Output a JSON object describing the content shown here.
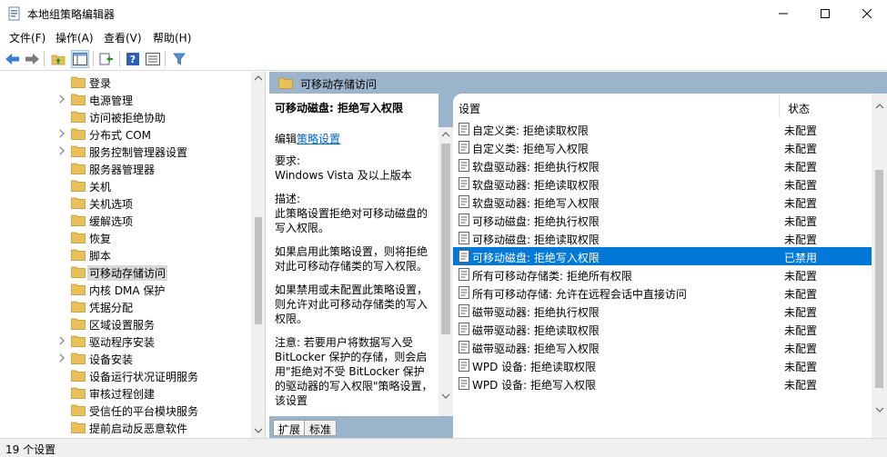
{
  "window": {
    "title": "本地组策略编辑器"
  },
  "menu": [
    {
      "label": "文件(F)"
    },
    {
      "label": "操作(A)"
    },
    {
      "label": "查看(V)"
    },
    {
      "label": "帮助(H)"
    }
  ],
  "toolbar": {
    "icons": [
      "back-arrow-icon",
      "forward-arrow-icon",
      "up-folder-icon",
      "show-hide-tree-icon",
      "export-list-icon",
      "help-icon",
      "properties-icon",
      "filter-icon"
    ]
  },
  "tree": {
    "items": [
      {
        "label": "登录",
        "has_children": false
      },
      {
        "label": "电源管理",
        "has_children": true
      },
      {
        "label": "访问被拒绝协助",
        "has_children": false
      },
      {
        "label": "分布式 COM",
        "has_children": true
      },
      {
        "label": "服务控制管理器设置",
        "has_children": true
      },
      {
        "label": "服务器管理器",
        "has_children": false
      },
      {
        "label": "关机",
        "has_children": false
      },
      {
        "label": "关机选项",
        "has_children": false
      },
      {
        "label": "缓解选项",
        "has_children": false
      },
      {
        "label": "恢复",
        "has_children": false
      },
      {
        "label": "脚本",
        "has_children": false
      },
      {
        "label": "可移动存储访问",
        "has_children": false,
        "selected": true
      },
      {
        "label": "内核 DMA 保护",
        "has_children": false
      },
      {
        "label": "凭据分配",
        "has_children": false
      },
      {
        "label": "区域设置服务",
        "has_children": false
      },
      {
        "label": "驱动程序安装",
        "has_children": true
      },
      {
        "label": "设备安装",
        "has_children": true
      },
      {
        "label": "设备运行状况证明服务",
        "has_children": false
      },
      {
        "label": "审核过程创建",
        "has_children": false
      },
      {
        "label": "受信任的平台模块服务",
        "has_children": false
      },
      {
        "label": "提前启动反恶意软件",
        "has_children": false
      }
    ]
  },
  "right_panel": {
    "header": "可移动存储访问"
  },
  "description": {
    "title": "可移动磁盘: 拒绝写入权限",
    "edit_prefix": "编辑",
    "edit_link": "策略设置",
    "requirements_label": "要求:",
    "requirements": "Windows Vista 及以上版本",
    "desc_label": "描述:",
    "desc_text": "此策略设置拒绝对可移动磁盘的写入权限。",
    "enabled_text": "如果启用此策略设置，则将拒绝对此可移动存储类的写入权限。",
    "disabled_text": "如果禁用或未配置此策略设置，则允许对此可移动存储类的写入权限。",
    "note_text": "注意: 若要用户将数据写入受 BitLocker 保护的存储，则会启用\"拒绝对不受 BitLocker 保护的驱动器的写入权限\"策略设置，该设置"
  },
  "tabs": [
    {
      "label": "扩展"
    },
    {
      "label": "标准"
    }
  ],
  "list": {
    "columns": {
      "setting": "设置",
      "state": "状态"
    },
    "rows": [
      {
        "name": "自定义类: 拒绝读取权限",
        "state": "未配置"
      },
      {
        "name": "自定义类: 拒绝写入权限",
        "state": "未配置"
      },
      {
        "name": "软盘驱动器: 拒绝执行权限",
        "state": "未配置"
      },
      {
        "name": "软盘驱动器: 拒绝读取权限",
        "state": "未配置"
      },
      {
        "name": "软盘驱动器: 拒绝写入权限",
        "state": "未配置"
      },
      {
        "name": "可移动磁盘: 拒绝执行权限",
        "state": "未配置"
      },
      {
        "name": "可移动磁盘: 拒绝读取权限",
        "state": "未配置"
      },
      {
        "name": "可移动磁盘: 拒绝写入权限",
        "state": "已禁用",
        "selected": true
      },
      {
        "name": "所有可移动存储类: 拒绝所有权限",
        "state": "未配置"
      },
      {
        "name": "所有可移动存储: 允许在远程会话中直接访问",
        "state": "未配置"
      },
      {
        "name": "磁带驱动器: 拒绝执行权限",
        "state": "未配置"
      },
      {
        "name": "磁带驱动器: 拒绝读取权限",
        "state": "未配置"
      },
      {
        "name": "磁带驱动器: 拒绝写入权限",
        "state": "未配置"
      },
      {
        "name": "WPD 设备: 拒绝读取权限",
        "state": "未配置"
      },
      {
        "name": "WPD 设备: 拒绝写入权限",
        "state": "未配置"
      }
    ]
  },
  "status": {
    "text": "19 个设置"
  },
  "colors": {
    "selection": "#0078d7",
    "panel_header": "#9bb4cb",
    "link": "#0066cc",
    "folder": "#e8c15a"
  }
}
